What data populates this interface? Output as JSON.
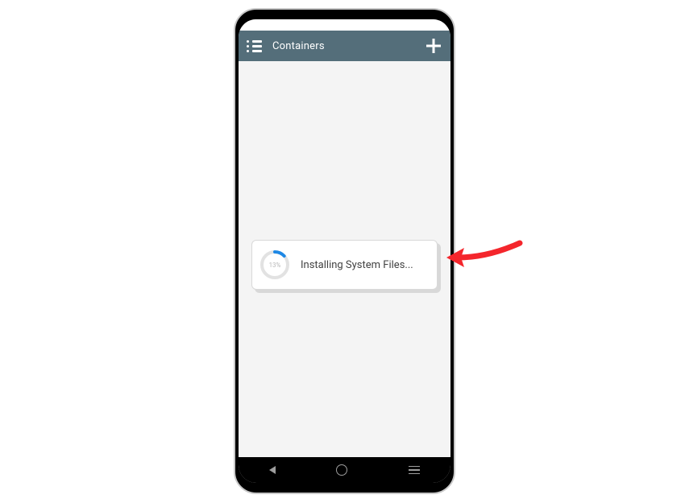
{
  "appbar": {
    "title": "Containers",
    "menu_icon": "menu-icon",
    "add_icon": "plus-icon"
  },
  "progress": {
    "percent": 13,
    "percent_label": "13%",
    "status_text": "Installing System Files..."
  },
  "colors": {
    "appbar_bg": "#546e7a",
    "accent": "#1e88e5",
    "arrow": "#f4262c"
  },
  "nav": {
    "back": "back",
    "home": "home",
    "recent": "recent"
  }
}
